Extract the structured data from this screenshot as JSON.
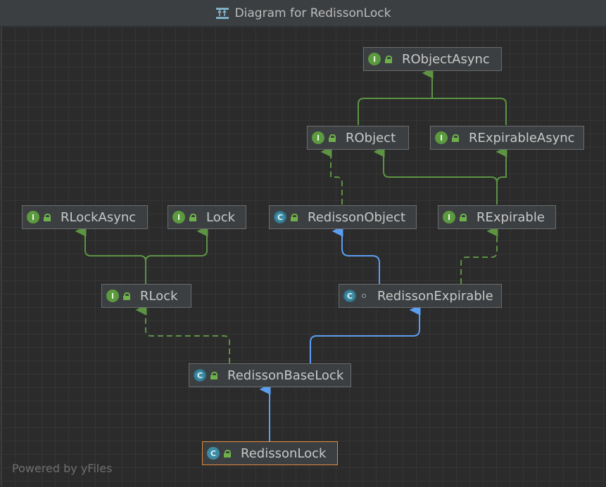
{
  "window": {
    "title": "Diagram for RedissonLock",
    "footer": "Powered by yFiles"
  },
  "colors": {
    "interface_edge": "#5d9443",
    "class_edge": "#5b9ef0",
    "selected_border": "#e08a3c"
  },
  "nodes": {
    "robjectasync": {
      "label": "RObjectAsync",
      "kind": "interface",
      "badge": "I"
    },
    "robject": {
      "label": "RObject",
      "kind": "interface",
      "badge": "I"
    },
    "rexpirableasync": {
      "label": "RExpirableAsync",
      "kind": "interface",
      "badge": "I"
    },
    "rlockasync": {
      "label": "RLockAsync",
      "kind": "interface",
      "badge": "I"
    },
    "lock": {
      "label": "Lock",
      "kind": "interface",
      "badge": "I"
    },
    "redissonobject": {
      "label": "RedissonObject",
      "kind": "abstract-class",
      "badge": "C"
    },
    "rexpirable": {
      "label": "RExpirable",
      "kind": "interface",
      "badge": "I"
    },
    "rlock": {
      "label": "RLock",
      "kind": "interface",
      "badge": "I"
    },
    "redissonexpirable": {
      "label": "RedissonExpirable",
      "kind": "abstract-class",
      "badge": "C"
    },
    "redissonbaselock": {
      "label": "RedissonBaseLock",
      "kind": "abstract-class",
      "badge": "C"
    },
    "redissonlock": {
      "label": "RedissonLock",
      "kind": "class",
      "badge": "C",
      "selected": true
    }
  }
}
